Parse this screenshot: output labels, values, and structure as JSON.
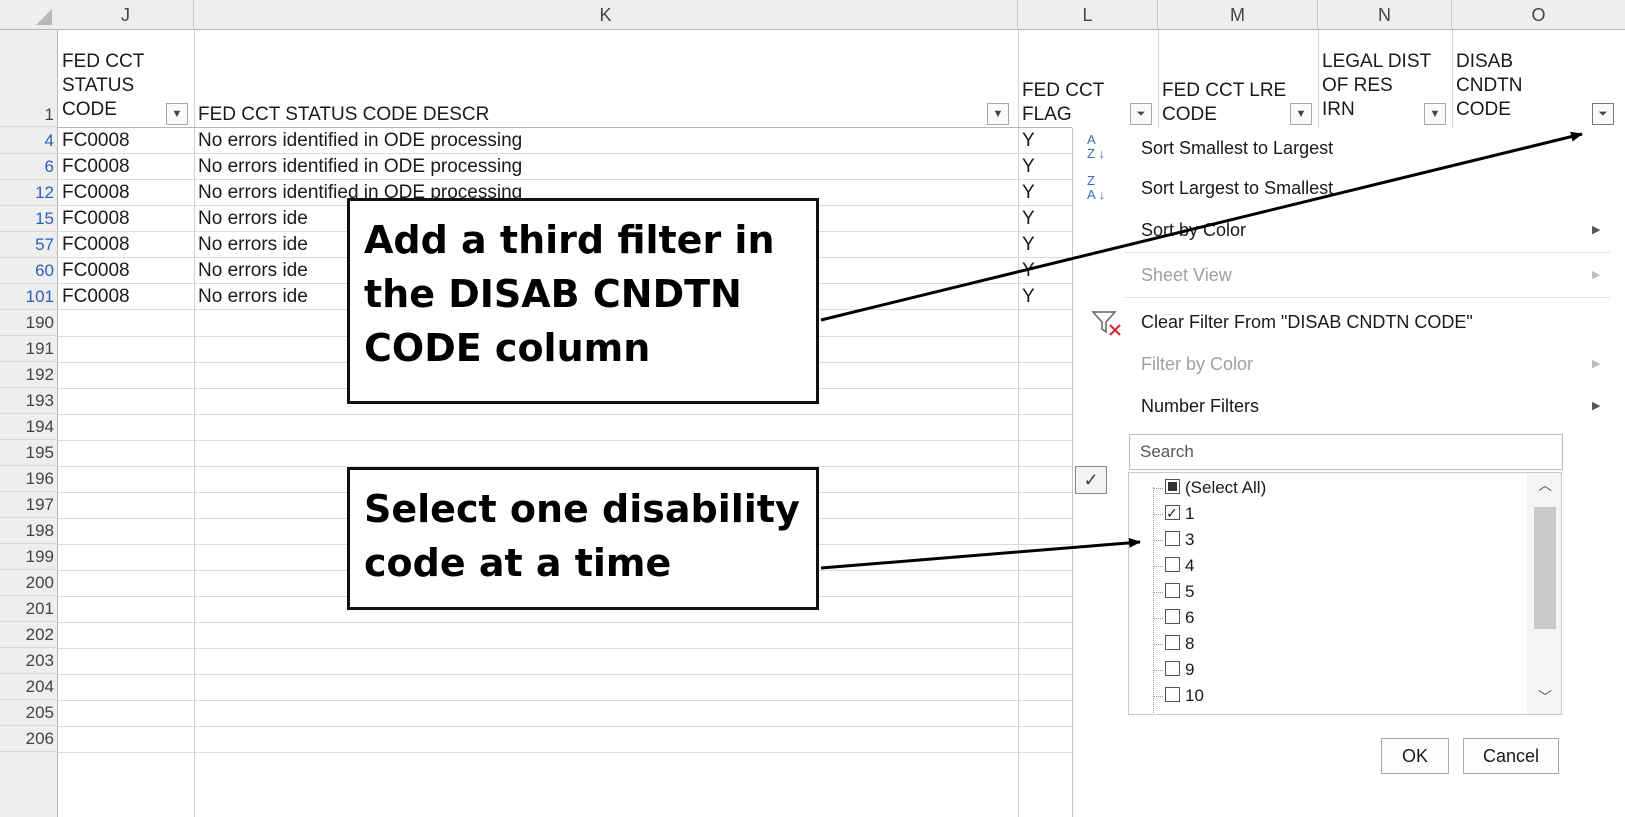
{
  "columns": {
    "J": "J",
    "K": "K",
    "L": "L",
    "M": "M",
    "N": "N",
    "O": "O"
  },
  "header_row_num": "1",
  "headers": {
    "J": "FED CCT\nSTATUS\nCODE",
    "K": "FED CCT STATUS CODE DESCR",
    "L": "FED CCT\nFLAG",
    "M": "FED CCT LRE\nCODE",
    "N": "LEGAL DIST\nOF RES\nIRN",
    "O": "DISAB\nCNDTN\nCODE"
  },
  "rows": [
    {
      "num": "4",
      "code": "FC0008",
      "descr": "No errors identified in ODE processing",
      "flag": "Y"
    },
    {
      "num": "6",
      "code": "FC0008",
      "descr": "No errors identified in ODE processing",
      "flag": "Y"
    },
    {
      "num": "12",
      "code": "FC0008",
      "descr": "No errors identified in ODE processing",
      "flag": "Y"
    },
    {
      "num": "15",
      "code": "FC0008",
      "descr": "No errors ide",
      "flag": "Y"
    },
    {
      "num": "57",
      "code": "FC0008",
      "descr": "No errors ide",
      "flag": "Y"
    },
    {
      "num": "60",
      "code": "FC0008",
      "descr": "No errors ide",
      "flag": "Y"
    },
    {
      "num": "101",
      "code": "FC0008",
      "descr": "No errors ide",
      "flag": "Y"
    }
  ],
  "empty_rows": [
    "190",
    "191",
    "192",
    "193",
    "194",
    "195",
    "196",
    "197",
    "198",
    "199",
    "200",
    "201",
    "202",
    "203",
    "204",
    "205",
    "206"
  ],
  "filter_menu": {
    "sort_asc": "Sort Smallest to Largest",
    "sort_desc": "Sort Largest to Smallest",
    "sort_color": "Sort by Color",
    "sheet_view": "Sheet View",
    "clear_filter": "Clear Filter From \"DISAB CNDTN CODE\"",
    "filter_color": "Filter by Color",
    "number_filters": "Number Filters",
    "search_placeholder": "Search",
    "items": [
      {
        "label": "(Select All)",
        "state": "partial"
      },
      {
        "label": "1",
        "state": "checked"
      },
      {
        "label": "3",
        "state": "unchecked"
      },
      {
        "label": "4",
        "state": "unchecked"
      },
      {
        "label": "5",
        "state": "unchecked"
      },
      {
        "label": "6",
        "state": "unchecked"
      },
      {
        "label": "8",
        "state": "unchecked"
      },
      {
        "label": "9",
        "state": "unchecked"
      },
      {
        "label": "10",
        "state": "unchecked"
      }
    ],
    "ok": "OK",
    "cancel": "Cancel"
  },
  "callouts": {
    "third_filter": "Add a third filter in the DISAB CNDTN CODE column",
    "select_one": "Select one disability code at a time"
  },
  "icons": {
    "sort_asc": "sort-a-z-icon",
    "sort_desc": "sort-z-a-icon",
    "clear_filter": "clear-filter-icon",
    "dropdown": "dropdown-arrow-icon",
    "filter_active": "filter-active-icon",
    "checkmark": "checkmark-icon"
  }
}
